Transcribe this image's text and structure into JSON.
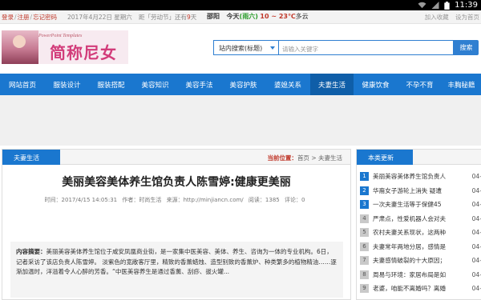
{
  "statusbar": {
    "time": "11:39"
  },
  "topbar": {
    "login": "登录",
    "register": "注册",
    "forgot": "忘记密码",
    "date": "2017年4月22日 星期六",
    "countdown_prefix": "距「劳动节」还有",
    "countdown_days": "9",
    "countdown_suffix": "天",
    "weather_city": "邵阳",
    "weather_day": "今天",
    "weather_sky": "(雨六)",
    "weather_temp": "10 ~ 23℃",
    "weather_wind": "多云",
    "bookmark": "加入收藏",
    "homepage": "设为首页"
  },
  "header": {
    "logo_tag": "PowerPoint Templates",
    "logo_text": "简称尼女性"
  },
  "search": {
    "select_value": "站内搜索(标题)",
    "placeholder": "请输入关键字",
    "button": "搜索"
  },
  "nav": {
    "items": [
      {
        "label": "网站首页"
      },
      {
        "label": "服装设计"
      },
      {
        "label": "服装搭配"
      },
      {
        "label": "美容知识"
      },
      {
        "label": "美容手法"
      },
      {
        "label": "美容护肤"
      },
      {
        "label": "婆媳关系"
      },
      {
        "label": "夫妻生活"
      },
      {
        "label": "健康饮食"
      },
      {
        "label": "不孕不育"
      },
      {
        "label": "丰胸秘籍"
      }
    ]
  },
  "main": {
    "section": "夫妻生活",
    "bc_label": "当前位置：",
    "bc_home": "首页",
    "bc_sep": " > ",
    "bc_current": "夫妻生活",
    "title": "美丽美容美体养生馆负责人陈雪婷:健康更美丽",
    "meta_time": "时间：2017/4/15 14:05:31",
    "meta_author": "作者：时尚生活",
    "meta_source": "来源：http://minjiancn.com/",
    "meta_views": "阅读：1385",
    "meta_comments": "评论：0",
    "summary_label": "内容摘要：",
    "summary_text": "美丽美容美体养生馆位于咸安凤凰商业街，是一家集中医美容、美体、养生、咨询为一体的专业机构。6日，记者采访了该店负责人陈雪婷。    淡紫色的宽敞客厅里，精致的香薰蜡烛、造型别致的香薰炉、种类繁多的植物精油……逐渐加温时，洋溢着令人心醉的芳香。“中医美容养生是通过香薰、刮痧、拔火罐..."
  },
  "sidebar": {
    "title": "本类更新",
    "items": [
      {
        "num": "1",
        "text": "美丽美容美体养生馆负责人",
        "date": "04-"
      },
      {
        "num": "2",
        "text": "华裔女子游轮上消失 疑遭",
        "date": "04-"
      },
      {
        "num": "3",
        "text": "一次夫妻生活等于保健45",
        "date": "04-"
      },
      {
        "num": "4",
        "text": "严肃点，性爱机器人会对夫",
        "date": "04-"
      },
      {
        "num": "5",
        "text": "农村夫妻关系现状，这两种",
        "date": "04-"
      },
      {
        "num": "6",
        "text": "夫妻常年两地分居，感情是",
        "date": "04-"
      },
      {
        "num": "7",
        "text": "夫妻感情破裂的十大原因；",
        "date": "04-"
      },
      {
        "num": "8",
        "text": "周易与环境：家居布局是如",
        "date": "04-"
      },
      {
        "num": "9",
        "text": "老婆，咱能不离婚吗？离婚",
        "date": "04-"
      }
    ]
  }
}
